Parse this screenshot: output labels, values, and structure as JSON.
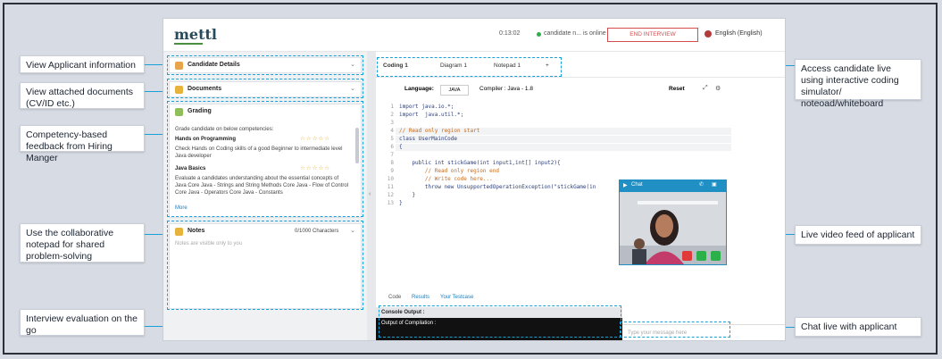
{
  "callouts": {
    "view_applicant": "View Applicant information",
    "view_documents": "View attached documents (CV/ID etc.)",
    "competency": "Competency-based feedback from Hiring Manger",
    "notepad": "Use the collaborative notepad for shared problem-solving",
    "evaluation": "Interview evaluation on the go",
    "access_candidate": "Access candidate live using interactive coding simulator/ noteoad/whiteboard",
    "live_video": "Live video feed of applicant",
    "chat_live": "Chat live with applicant"
  },
  "app": {
    "logo": "mettl",
    "timer": "0:13:02",
    "candidate_status": "candidate n... is online",
    "end_button": "END INTERVIEW",
    "language": "English (English)"
  },
  "left": {
    "candidate_details": "Candidate Details",
    "documents": "Documents",
    "grading": "Grading",
    "grading_intro": "Grade candidate on below competencies:",
    "skills": [
      {
        "name": "Hands on Programming",
        "desc": "Check Hands on Coding skills of a good Beginner to intermediate level Java developer",
        "stars": "☆☆☆☆☆"
      },
      {
        "name": "Java Basics",
        "desc": "Evaluate a candidates understanding about the essential concepts of Java Core Java - Strings and String Methods Core Java - Flow of Control Core Java - Operators Core Java - Constants",
        "stars": "☆☆☆☆☆"
      }
    ],
    "more": "More",
    "notes": "Notes",
    "notes_count": "0/1000 Characters",
    "notes_placeholder": "Notes are visible only to you"
  },
  "right": {
    "tabs": [
      "Coding 1",
      "Diagram 1",
      "Notepad 1",
      "+"
    ],
    "language_label": "Language:",
    "language_value": "JAVA",
    "compiler": "Compiler : Java - 1.8",
    "reset": "Reset",
    "code": [
      {
        "n": "1",
        "t": "import java.io.*;"
      },
      {
        "n": "2",
        "t": "import  java.util.*;"
      },
      {
        "n": "3",
        "t": ""
      },
      {
        "n": "4",
        "t": "// Read only region start"
      },
      {
        "n": "5",
        "t": "class UserMainCode"
      },
      {
        "n": "6",
        "t": "{"
      },
      {
        "n": "7",
        "t": ""
      },
      {
        "n": "8",
        "t": "    public int stickGame(int input1,int[] input2){"
      },
      {
        "n": "9",
        "t": "        // Read only region end"
      },
      {
        "n": "10",
        "t": "        // Write code here..."
      },
      {
        "n": "11",
        "t": "        throw new UnsupportedOperationException(\"stickGame(in"
      },
      {
        "n": "12",
        "t": "    }"
      },
      {
        "n": "13",
        "t": "}"
      }
    ],
    "bottom_tabs": [
      "Code",
      "Results",
      "Your Testcase"
    ],
    "console_output": "Console Output :",
    "output_compilation": "Output of Compilation :",
    "chat_placeholder": "Type your message here",
    "video_title": "Chat"
  }
}
